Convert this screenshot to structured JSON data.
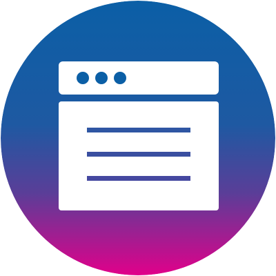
{
  "icon": {
    "name": "browser-window-icon",
    "description_visible": false
  },
  "colors": {
    "gradient_top": "#0B5FA6",
    "gradient_mid": "#2D4E9E",
    "gradient_bottom": "#E1008A",
    "window_fill": "#FFFFFF",
    "window_accent": "#0B5FA6",
    "line_color": "#3A4FA0",
    "background": "#FFFFFF"
  },
  "window": {
    "dot_count": 3,
    "text_line_count": 3
  }
}
